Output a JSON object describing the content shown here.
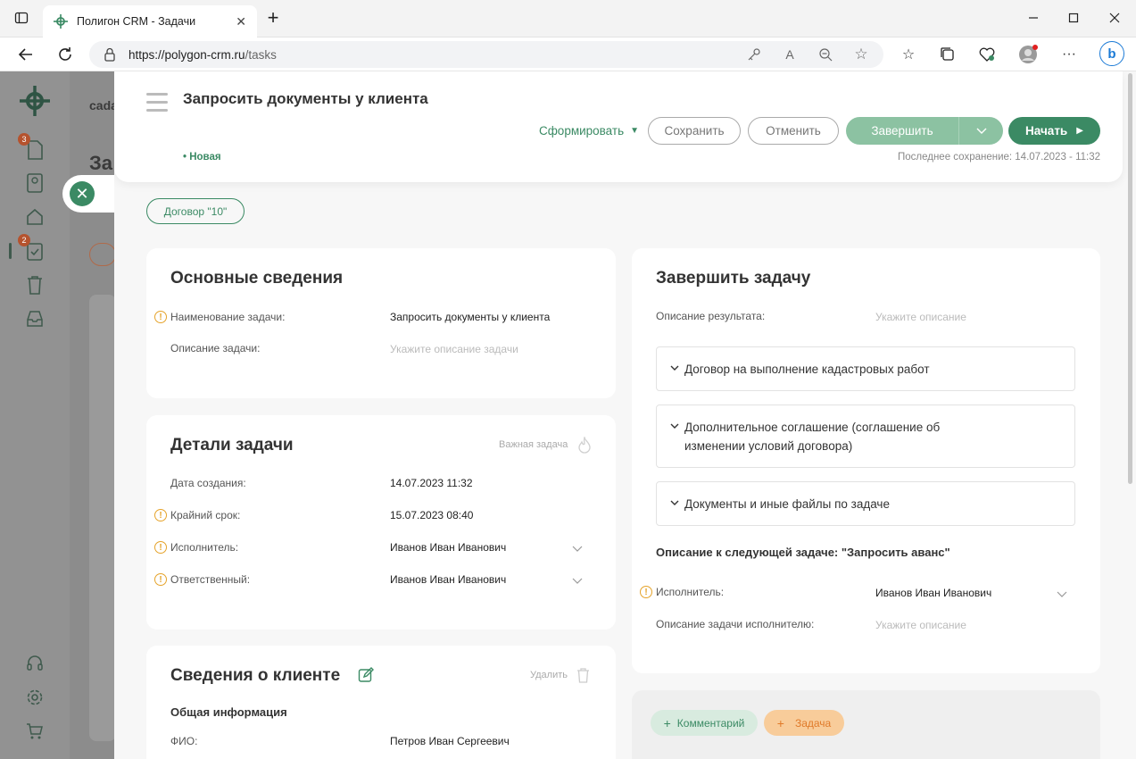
{
  "browser": {
    "tab_title": "Полигон CRM - Задачи",
    "url_host": "https://polygon-crm.ru",
    "url_path": "/tasks"
  },
  "background": {
    "badge_1": "3",
    "badge_2": "2",
    "frag_1": "cada",
    "frag_2": "За"
  },
  "header": {
    "title": "Запросить документы у клиента",
    "status": "• Новая",
    "last_save": "Последнее сохранение: 14.07.2023 - 11:32",
    "btn_form": "Сформировать",
    "btn_save": "Сохранить",
    "btn_cancel": "Отменить",
    "btn_finish": "Завершить",
    "btn_start": "Начать"
  },
  "contract_chip": "Договор \"10\"",
  "main_info": {
    "title": "Основные сведения",
    "name_label": "Наименование задачи:",
    "name_value": "Запросить документы у клиента",
    "desc_label": "Описание задачи:",
    "desc_placeholder": "Укажите описание задачи"
  },
  "details": {
    "title": "Детали задачи",
    "important": "Важная задача",
    "created_label": "Дата создания:",
    "created_value": "14.07.2023 11:32",
    "deadline_label": "Крайний срок:",
    "deadline_value": "15.07.2023 08:40",
    "executor_label": "Исполнитель:",
    "executor_value": "Иванов Иван Иванович",
    "responsible_label": "Ответственный:",
    "responsible_value": "Иванов Иван Иванович"
  },
  "client": {
    "title": "Сведения о клиенте",
    "delete": "Удалить",
    "general": "Общая информация",
    "fio_label": "ФИО:",
    "fio_value": "Петров Иван Сергеевич"
  },
  "complete": {
    "title": "Завершить задачу",
    "result_label": "Описание результата:",
    "result_placeholder": "Укажите описание",
    "acc1": "Договор на выполнение кадастровых работ",
    "acc2": "Дополнительное соглашение (соглашение об изменении условий договора)",
    "acc3": "Документы и иные файлы по задаче",
    "next_title": "Описание к следующей задаче: \"Запросить аванс\"",
    "executor_label": "Исполнитель:",
    "executor_value": "Иванов Иван Иванович",
    "exec_desc_label": "Описание задачи исполнителю:",
    "exec_desc_placeholder": "Укажите описание"
  },
  "actions": {
    "comment": "Комментарий",
    "task": "Задача"
  },
  "colors": {
    "brand_green": "#3b8a64",
    "light_green": "#8cc2a2",
    "warning": "#e5a32a"
  }
}
